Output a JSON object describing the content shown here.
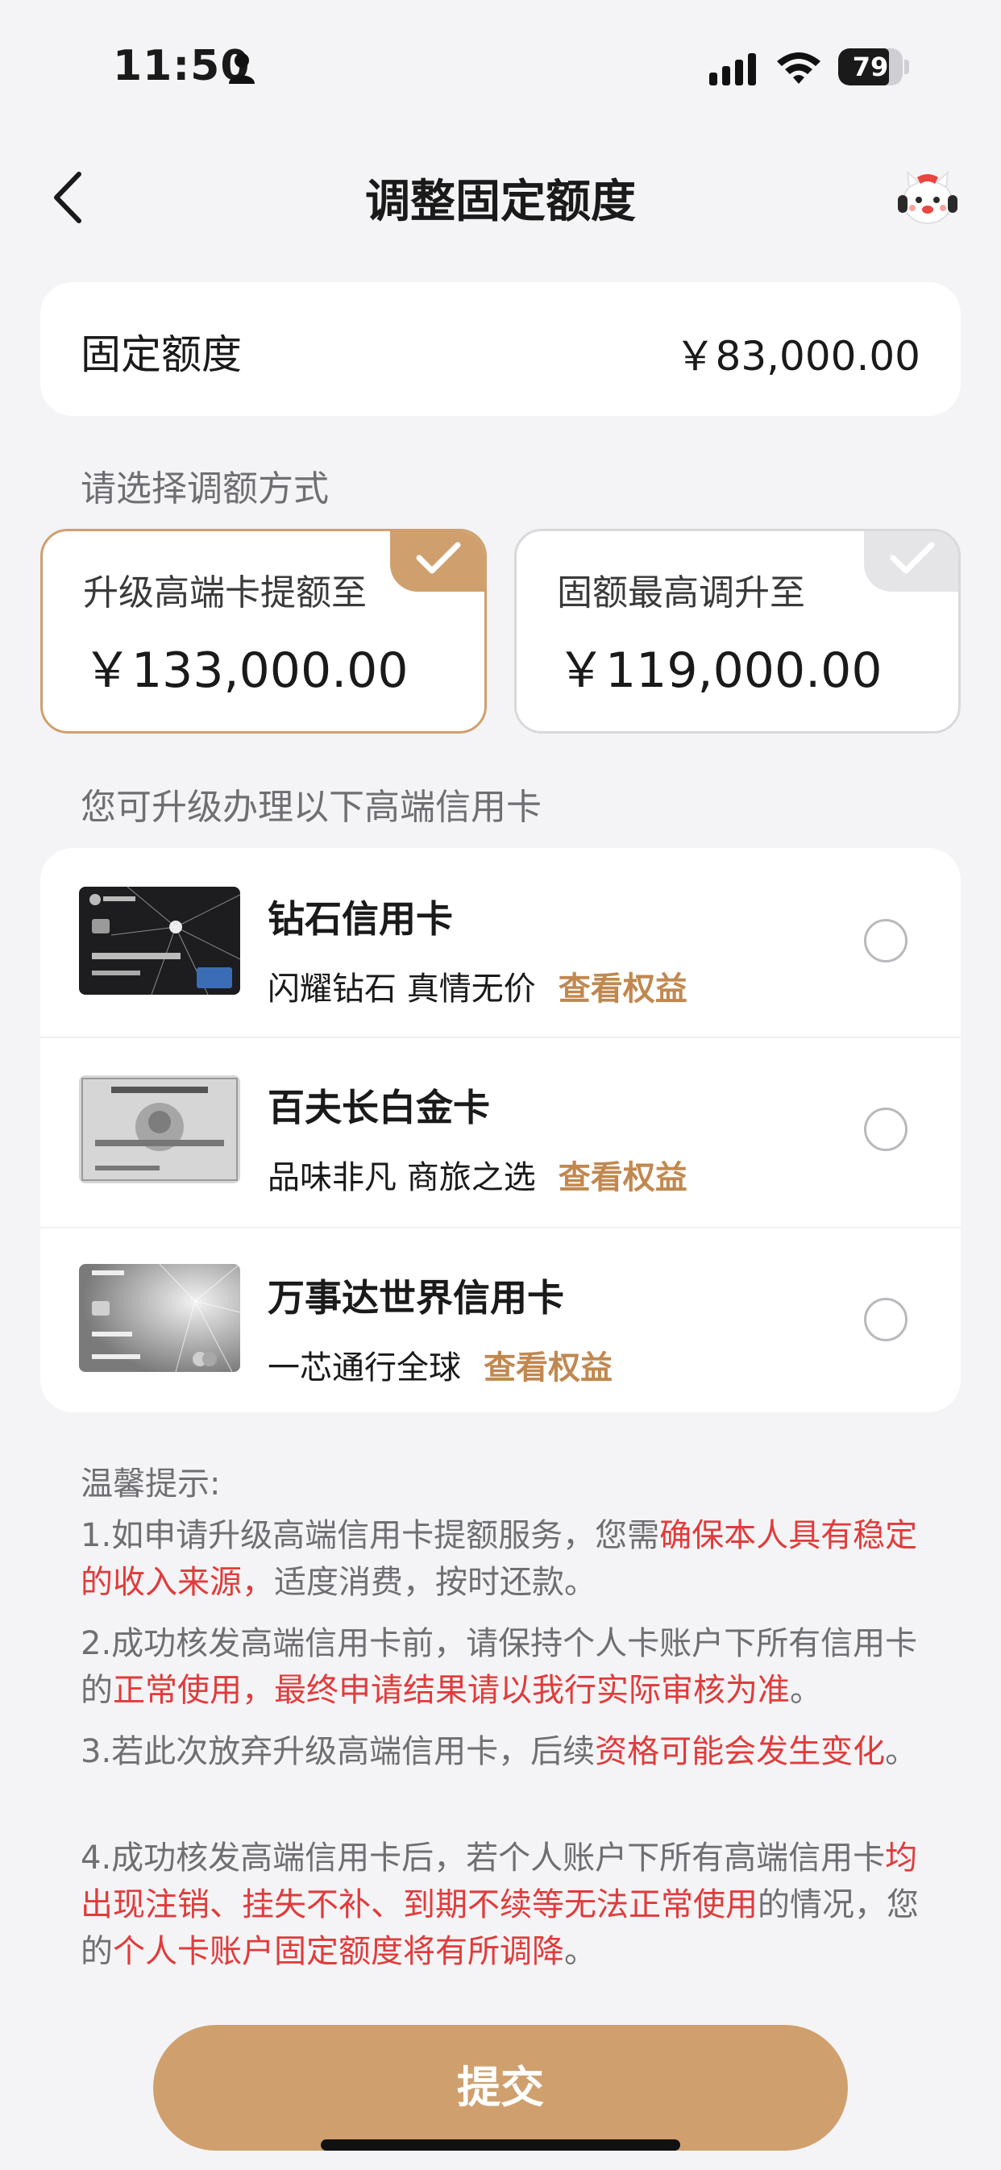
{
  "status": {
    "time": "11:50",
    "battery": "79",
    "battery_level": 0.79
  },
  "nav": {
    "title": "调整固定额度",
    "back_icon": "chevron-left-icon",
    "assistant_icon": "assistant-mascot-icon"
  },
  "fixed_limit": {
    "label": "固定额度",
    "value": "￥83,000.00"
  },
  "select_label": "请选择调额方式",
  "options": [
    {
      "label": "升级高端卡提额至",
      "value": "￥133,000.00",
      "selected": true
    },
    {
      "label": "固额最高调升至",
      "value": "￥119,000.00",
      "selected": false
    }
  ],
  "cards_label": "您可升级办理以下高端信用卡",
  "cards": [
    {
      "name": "钻石信用卡",
      "desc": "闪耀钻石 真情无价",
      "link": "查看权益"
    },
    {
      "name": "百夫长白金卡",
      "desc": "品味非凡 商旅之选",
      "link": "查看权益"
    },
    {
      "name": "万事达世界信用卡",
      "desc": "一芯通行全球",
      "link": "查看权益"
    }
  ],
  "tips": {
    "title": "温馨提示:",
    "t1": {
      "a": "1.如申请升级高端信用卡提额服务，您需",
      "b": "确保本人具有稳定的收入来源，",
      "c": "适度消费，按时还款。"
    },
    "t2": {
      "a": "2.成功核发高端信用卡前，请保持个人卡账户下所有信用卡的",
      "b": "正常使用，最终申请结果请以我行实际审核为准",
      "c": "。"
    },
    "t3": {
      "a": "3.若此次放弃升级高端信用卡，后续",
      "b": "资格可能会发生变化",
      "c": "。"
    },
    "t4": {
      "a": "4.成功核发高端信用卡后，若个人账户下所有高端信用卡",
      "b": "均出现注销、挂失不补、到期不续等无法正常使用",
      "c": "的情况，您的",
      "d": "个人卡账户固定额度将有所调降",
      "e": "。"
    }
  },
  "submit_label": "提交",
  "colors": {
    "accent": "#cfa06e",
    "warning": "#e13b3b",
    "link": "#c08850"
  }
}
